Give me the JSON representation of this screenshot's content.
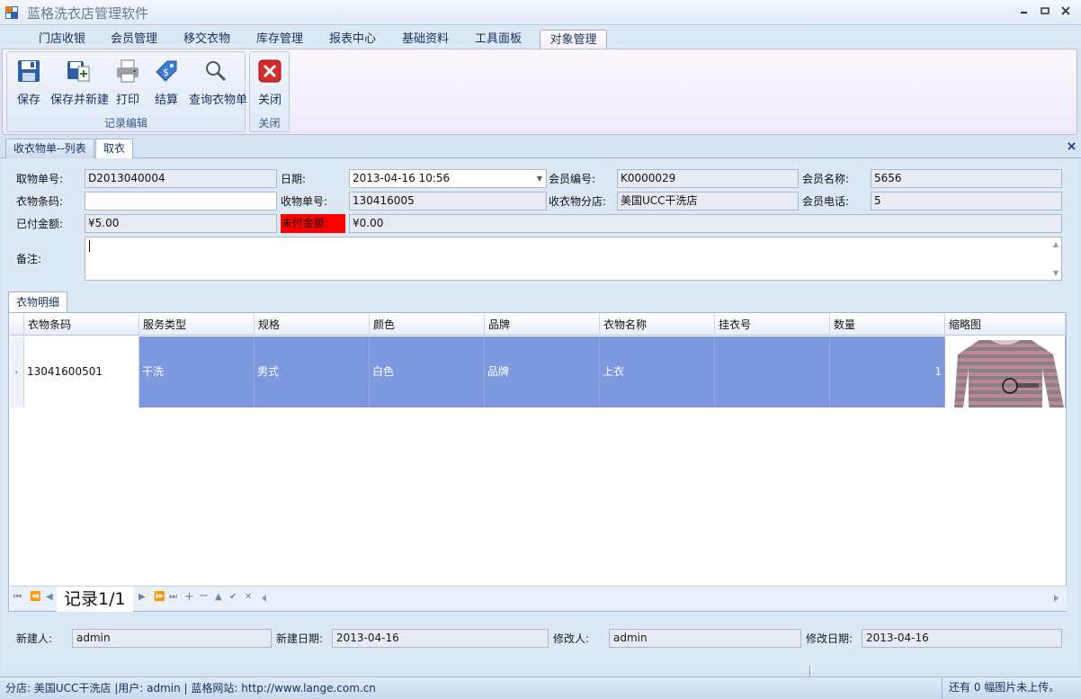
{
  "window": {
    "title": "蓝格洗衣店管理软件",
    "controls": [
      "minimize",
      "maximize",
      "close"
    ]
  },
  "ribbon": {
    "tabs": [
      "门店收银",
      "会员管理",
      "移交衣物",
      "库存管理",
      "报表中心",
      "基础资料",
      "工具面板",
      "对象管理"
    ],
    "active_tab": "对象管理",
    "groups": [
      {
        "label": "记录编辑",
        "buttons": [
          {
            "label": "保存",
            "icon": "floppy-disk-icon"
          },
          {
            "label": "保存并新建",
            "icon": "save-new-icon"
          },
          {
            "label": "打印",
            "icon": "printer-icon"
          },
          {
            "label": "结算",
            "icon": "price-tag-icon"
          },
          {
            "label": "查询衣物单",
            "icon": "magnifier-icon"
          }
        ]
      },
      {
        "label": "关闭",
        "buttons": [
          {
            "label": "关闭",
            "icon": "close-red-icon"
          }
        ]
      }
    ]
  },
  "doc_tabs": [
    "收衣物单--列表",
    "取衣"
  ],
  "active_doc_tab": "取衣",
  "form": {
    "pickup_no": {
      "label": "取物单号:",
      "value": "D2013040004"
    },
    "date": {
      "label": "日期:",
      "value": "2013-04-16 10:56"
    },
    "member_no": {
      "label": "会员编号:",
      "value": "K0000029"
    },
    "member_name": {
      "label": "会员名称:",
      "value": "5656"
    },
    "barcode": {
      "label": "衣物条码:",
      "value": ""
    },
    "receive_no": {
      "label": "收物单号:",
      "value": "130416005"
    },
    "receive_branch": {
      "label": "收衣物分店:",
      "value": "美国UCC干洗店"
    },
    "member_phone": {
      "label": "会员电话:",
      "value": "5"
    },
    "paid": {
      "label": "已付金额:",
      "value": "¥5.00"
    },
    "unpaid": {
      "label": "未付金额:",
      "value": "¥0.00"
    },
    "remark": {
      "label": "备注:",
      "value": ""
    }
  },
  "detail_tab": "衣物明细",
  "grid": {
    "columns": [
      "衣物条码",
      "服务类型",
      "规格",
      "颜色",
      "品牌",
      "衣物名称",
      "挂衣号",
      "数量",
      "缩略图"
    ],
    "rows": [
      {
        "barcode": "13041600501",
        "service": "干洗",
        "spec": "男式",
        "color": "白色",
        "brand": "品牌",
        "name": "上衣",
        "hang_no": "",
        "qty": "1",
        "thumb": "striped-sweater-thumbnail"
      }
    ],
    "row_indicator": "›",
    "navigator": {
      "record_text": "记录1/1"
    }
  },
  "footer": {
    "creator": {
      "label": "新建人:",
      "value": "admin"
    },
    "created_date": {
      "label": "新建日期:",
      "value": "2013-04-16"
    },
    "modifier": {
      "label": "修改人:",
      "value": "admin"
    },
    "modified_date": {
      "label": "修改日期:",
      "value": "2013-04-16"
    }
  },
  "status": {
    "left": "分店: 美国UCC干洗店 |用户: admin | 蓝格网站: http://www.lange.com.cn",
    "right": "还有 0 幅图片未上传。"
  },
  "colors": {
    "selected_row": "#7e98df",
    "unpaid_highlight": "#ff0000",
    "active_tab_border": "#b7a2d3"
  }
}
